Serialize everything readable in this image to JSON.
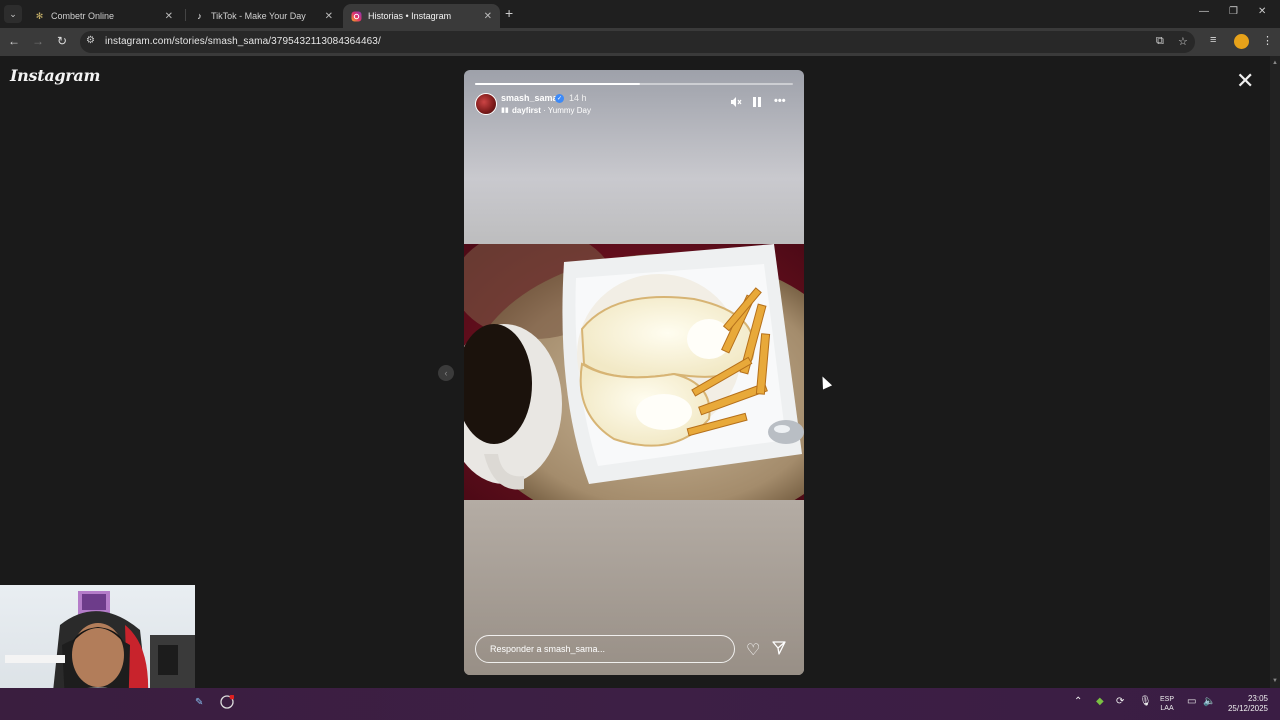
{
  "browser": {
    "tabs": [
      {
        "title": "Combetr Online",
        "favicon": "gear-icon",
        "active": false
      },
      {
        "title": "TikTok - Make Your Day",
        "favicon": "tiktok-icon",
        "active": false
      },
      {
        "title": "Historias • Instagram",
        "favicon": "instagram-icon",
        "active": true
      }
    ],
    "url": "instagram.com/stories/smash_sama/3795432113084364463/"
  },
  "page": {
    "logo": "Instagram",
    "story": {
      "username": "smash_sama",
      "time_ago": "14 h",
      "music_artist": "dayfirst",
      "music_separator": " · ",
      "music_title": "Yummy Day",
      "progress": 0.52,
      "reply_placeholder": "Responder a smash_sama..."
    }
  },
  "taskbar": {
    "lang_line1": "ESP",
    "lang_line2": "LAA",
    "time": "23:05",
    "date": "25/12/2025"
  }
}
